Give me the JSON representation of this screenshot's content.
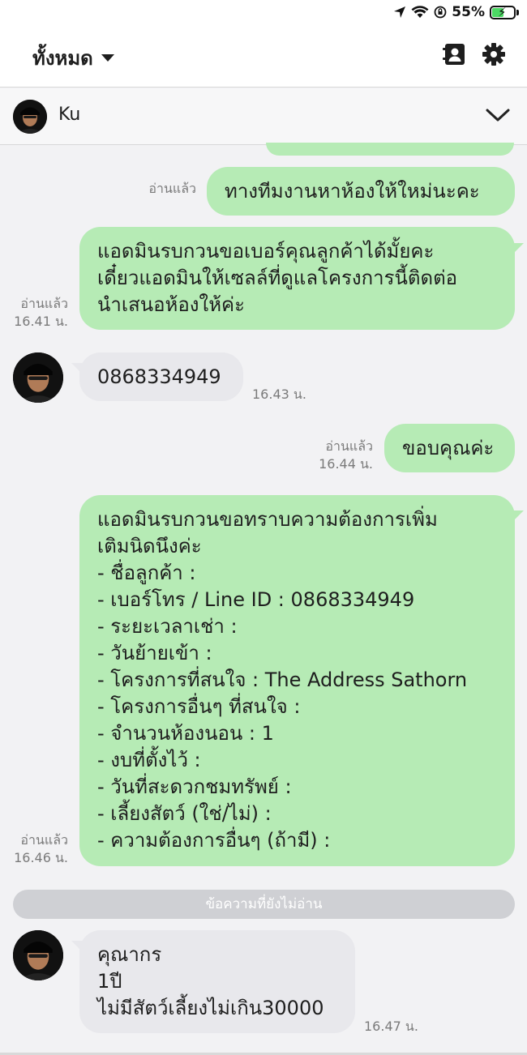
{
  "status_bar": {
    "battery": "55%"
  },
  "header": {
    "filter_label": "ทั้งหมด"
  },
  "chat": {
    "contact_name": "Ku"
  },
  "messages": [
    {
      "text": "ทางทีมงานหาห้องให้ใหม่นะคะ",
      "read": "อ่านแล้ว"
    },
    {
      "lines": [
        "แอดมินรบกวนขอเบอร์คุณลูกค้าได้มั้ยคะ",
        "เดี๋ยวแอดมินให้เซลล์ที่ดูแลโครงการนี้ติดต่อ",
        "นำเสนอห้องให้ค่ะ"
      ],
      "read": "อ่านแล้ว",
      "time": "16.41 น."
    },
    {
      "text": "0868334949",
      "time": "16.43 น."
    },
    {
      "text": "ขอบคุณค่ะ",
      "read": "อ่านแล้ว",
      "time": "16.44 น."
    },
    {
      "lines": [
        "แอดมินรบกวนขอทราบความต้องการเพิ่ม",
        "เติมนิดนึงค่ะ",
        "- ชื่อลูกค้า :",
        "- เบอร์โทร / Line ID : 0868334949",
        "- ระยะเวลาเช่า :",
        "- วันย้ายเข้า :",
        "- โครงการที่สนใจ : The Address Sathorn",
        "- โครงการอื่นๆ ที่สนใจ :",
        "- จำนวนห้องนอน : 1",
        "- งบที่ตั้งไว้ :",
        "- วันที่สะดวกชมทรัพย์ :",
        "- เลี้ยงสัตว์ (ใช่/ไม่) :",
        "- ความต้องการอื่นๆ (ถ้ามี) :"
      ],
      "read": "อ่านแล้ว",
      "time": "16.46 น."
    },
    {
      "lines": [
        "คุณากร",
        "1ปี",
        "ไม่มีสัตว์เลี้ยงไม่เกิน30000"
      ],
      "time": "16.47 น."
    }
  ],
  "unread_divider": "ข้อความที่ยังไม่อ่าน",
  "icons": {
    "location": "location-arrow-icon",
    "wifi": "wifi-icon",
    "rotation_lock": "rotation-lock-icon",
    "battery": "battery-charging-icon",
    "contacts": "contacts-icon",
    "settings": "gear-icon",
    "collapse": "chevron-down-icon"
  },
  "colors": {
    "outgoing_bubble": "#b6ebb5",
    "incoming_bubble": "#e8e8ec",
    "background": "#f2f2f4"
  }
}
